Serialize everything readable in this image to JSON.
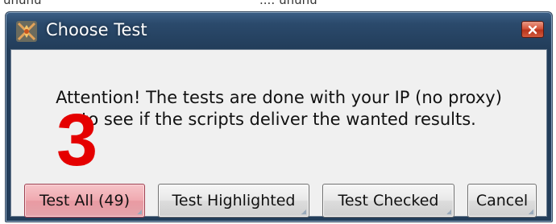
{
  "backdrop": {
    "left_text": "ununu",
    "right_text": "...: ununu"
  },
  "window": {
    "title": "Choose Test",
    "icon": "app-flame-icon",
    "close_icon": "close-icon"
  },
  "message": {
    "line1": "Attention! The tests are done with your IP (no proxy)",
    "line2": "to see if the scripts deliver the wanted results."
  },
  "annotation": {
    "text": "3",
    "color": "#e50000"
  },
  "buttons": {
    "test_all": "Test All (49)",
    "test_highlighted": "Test Highlighted",
    "test_checked": "Test Checked",
    "cancel": "Cancel"
  },
  "colors": {
    "titlebar": "#2b4a6c",
    "focused_button": "#f0aab1",
    "close_button": "#d6543a"
  }
}
